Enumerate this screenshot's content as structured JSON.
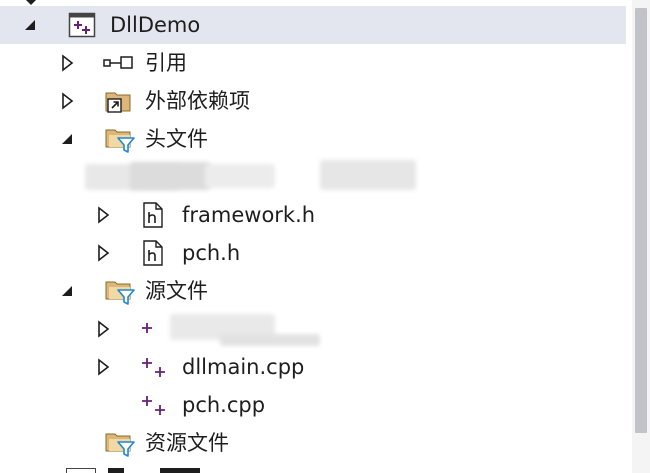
{
  "project": {
    "name": "DllDemo"
  },
  "nodes": {
    "references": {
      "label": "引用"
    },
    "external_deps": {
      "label": "外部依赖项"
    },
    "header_files": {
      "label": "头文件"
    },
    "framework_h": {
      "label": "framework.h"
    },
    "pch_h": {
      "label": "pch.h"
    },
    "source_files": {
      "label": "源文件"
    },
    "dllmain_cpp": {
      "label": "dllmain.cpp"
    },
    "pch_cpp": {
      "label": "pch.cpp"
    },
    "resource_files": {
      "label": "资源文件"
    }
  },
  "colors": {
    "selected_bg": "#e3e5ef",
    "project_purple": "#68217a",
    "folder_yellow": "#dcb67a",
    "filter_blue": "#1e88d4",
    "scroll_thumb": "#c2c3c9"
  }
}
